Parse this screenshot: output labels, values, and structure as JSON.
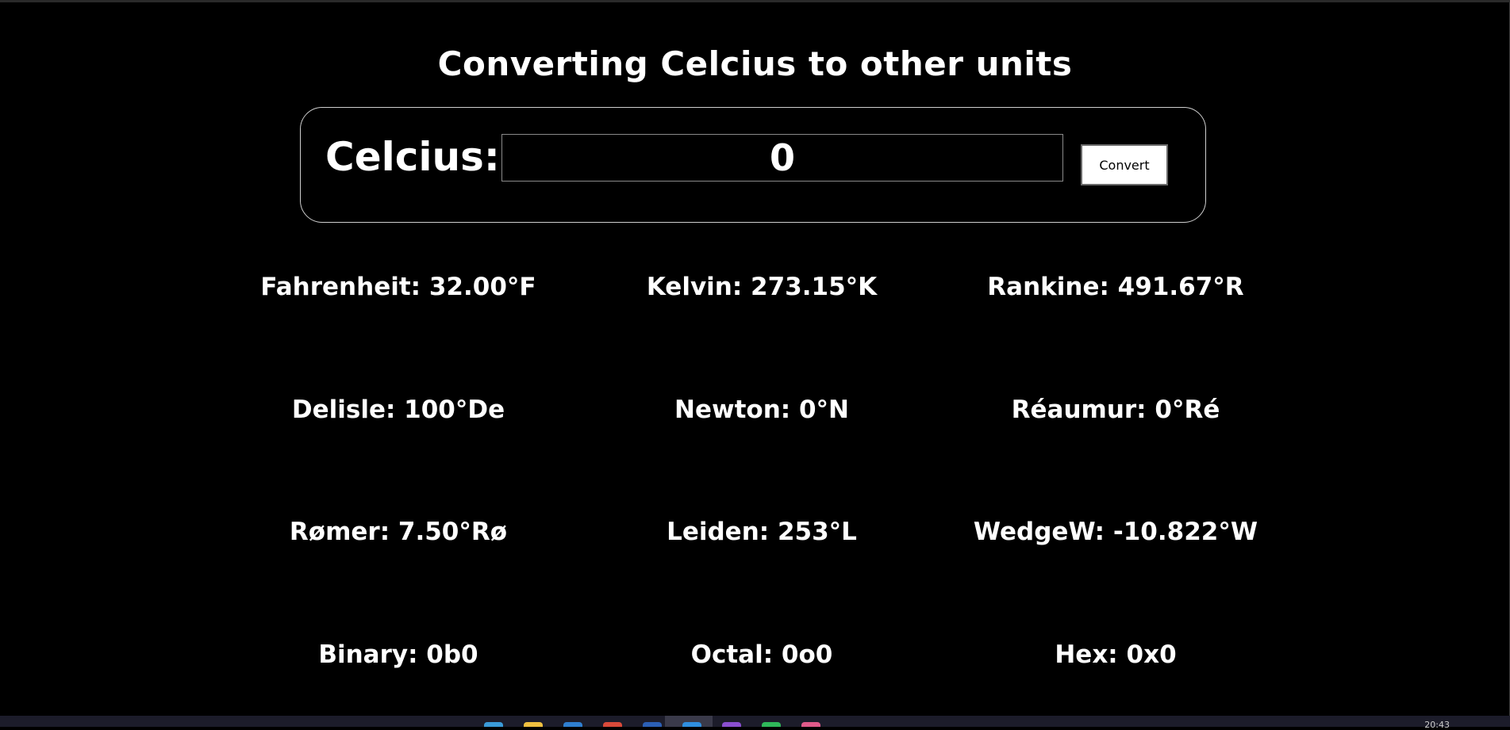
{
  "page": {
    "title": "Converting Celcius to other units"
  },
  "converter": {
    "label": "Celcius:",
    "input_value": "0",
    "convert_label": "Convert"
  },
  "results": [
    {
      "id": "fahrenheit",
      "text": "Fahrenheit: 32.00°F"
    },
    {
      "id": "kelvin",
      "text": "Kelvin: 273.15°K"
    },
    {
      "id": "rankine",
      "text": "Rankine: 491.67°R"
    },
    {
      "id": "delisle",
      "text": "Delisle: 100°De"
    },
    {
      "id": "newton",
      "text": "Newton: 0°N"
    },
    {
      "id": "reaumur",
      "text": "Réaumur: 0°Ré"
    },
    {
      "id": "romer",
      "text": "Rømer: 7.50°Rø"
    },
    {
      "id": "leiden",
      "text": "Leiden: 253°L"
    },
    {
      "id": "wedgewood",
      "text": "WedgeW: -10.822°W"
    },
    {
      "id": "binary",
      "text": "Binary: 0b0"
    },
    {
      "id": "octal",
      "text": "Octal: 0o0"
    },
    {
      "id": "hex",
      "text": "Hex: 0x0"
    }
  ],
  "taskbar": {
    "clock": "20:43",
    "icons": [
      {
        "name": "edge-icon",
        "color": "#3a9bd9"
      },
      {
        "name": "folder-icon",
        "color": "#f0c040"
      },
      {
        "name": "store-icon",
        "color": "#2f7fd0"
      },
      {
        "name": "chrome-icon",
        "color": "#d94a3a"
      },
      {
        "name": "word-icon",
        "color": "#2b5fb5"
      },
      {
        "name": "vscode-icon",
        "color": "#2f8fe0"
      },
      {
        "name": "app-icon",
        "color": "#8a4fd0"
      },
      {
        "name": "spotify-icon",
        "color": "#2fb85a"
      },
      {
        "name": "photos-icon",
        "color": "#e05a8a"
      }
    ]
  },
  "colors": {
    "background": "#000000",
    "text": "#ffffff",
    "panel_border": "#cfcfcf"
  }
}
